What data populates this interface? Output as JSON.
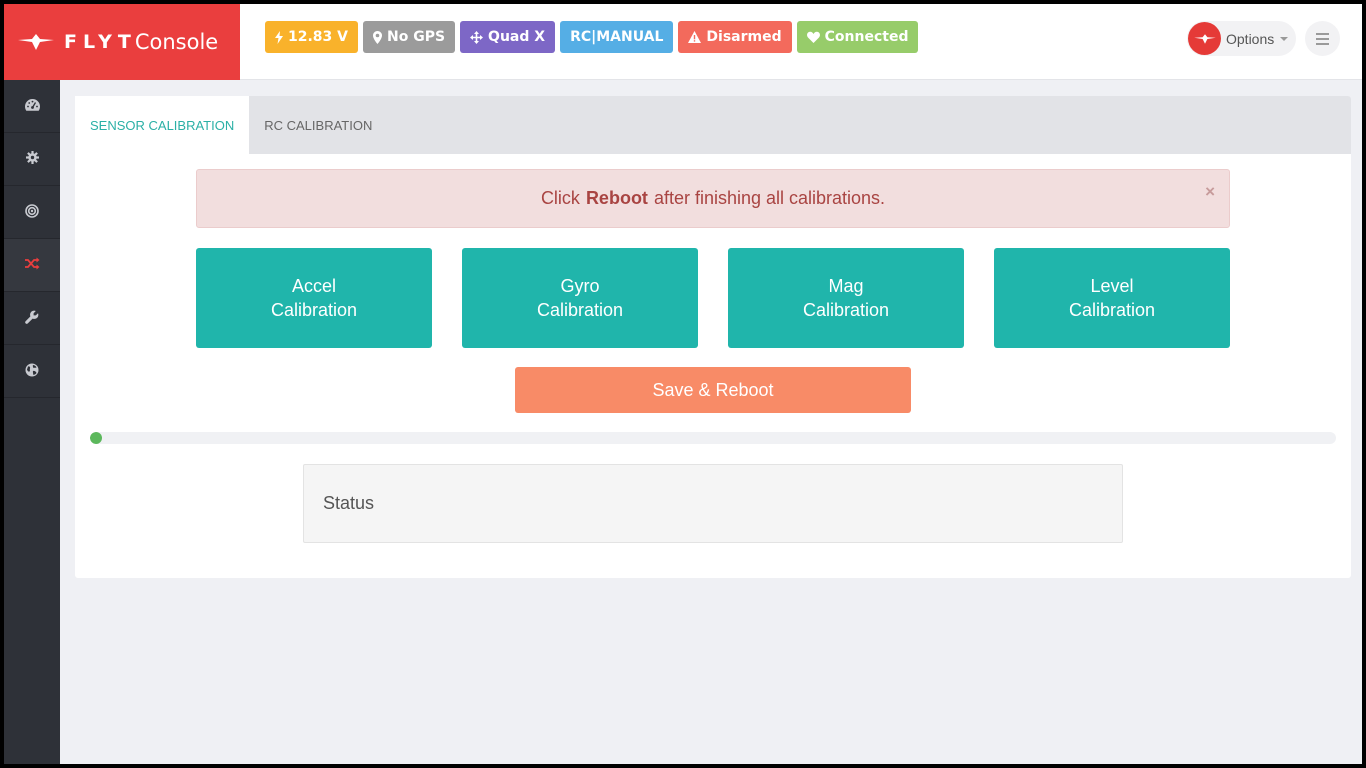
{
  "brand": {
    "flyt": "FLYT",
    "console": "Console"
  },
  "badges": {
    "battery": {
      "icon": "bolt-icon",
      "label": "12.83 V",
      "color": "#f9b22b"
    },
    "gps": {
      "icon": "map-marker-icon",
      "label": "No GPS",
      "color": "#9b9b9b"
    },
    "frame": {
      "icon": "arrows-move-icon",
      "label": "Quad X",
      "color": "#7d67c6"
    },
    "rc_mode": {
      "label": "RC|MANUAL",
      "color": "#55aee5"
    },
    "armed": {
      "icon": "warning-icon",
      "label": "Disarmed",
      "color": "#f36a5c"
    },
    "connection": {
      "icon": "heart-icon",
      "label": "Connected",
      "color": "#97cc6a"
    }
  },
  "header": {
    "options_label": "Options"
  },
  "sidebar": {
    "items": [
      {
        "icon": "dashboard-icon",
        "active": false
      },
      {
        "icon": "gear-icon",
        "active": false
      },
      {
        "icon": "target-icon",
        "active": false
      },
      {
        "icon": "shuffle-icon",
        "active": true
      },
      {
        "icon": "wrench-icon",
        "active": false
      },
      {
        "icon": "globe-icon",
        "active": false
      }
    ]
  },
  "tabs": [
    {
      "label": "SENSOR CALIBRATION",
      "active": true
    },
    {
      "label": "RC CALIBRATION",
      "active": false
    }
  ],
  "alert": {
    "prefix": "Click",
    "bold": "Reboot",
    "suffix": "after finishing all calibrations.",
    "close": "×"
  },
  "calibration": [
    {
      "line1": "Accel",
      "line2": "Calibration"
    },
    {
      "line1": "Gyro",
      "line2": "Calibration"
    },
    {
      "line1": "Mag",
      "line2": "Calibration"
    },
    {
      "line1": "Level",
      "line2": "Calibration"
    }
  ],
  "save_button": "Save & Reboot",
  "progress": {
    "percent": 1
  },
  "status": {
    "label": "Status"
  },
  "colors": {
    "accent": "#20b5ab",
    "brand": "#ea3e3e",
    "save": "#f88b67",
    "progress": "#5cb85c"
  }
}
